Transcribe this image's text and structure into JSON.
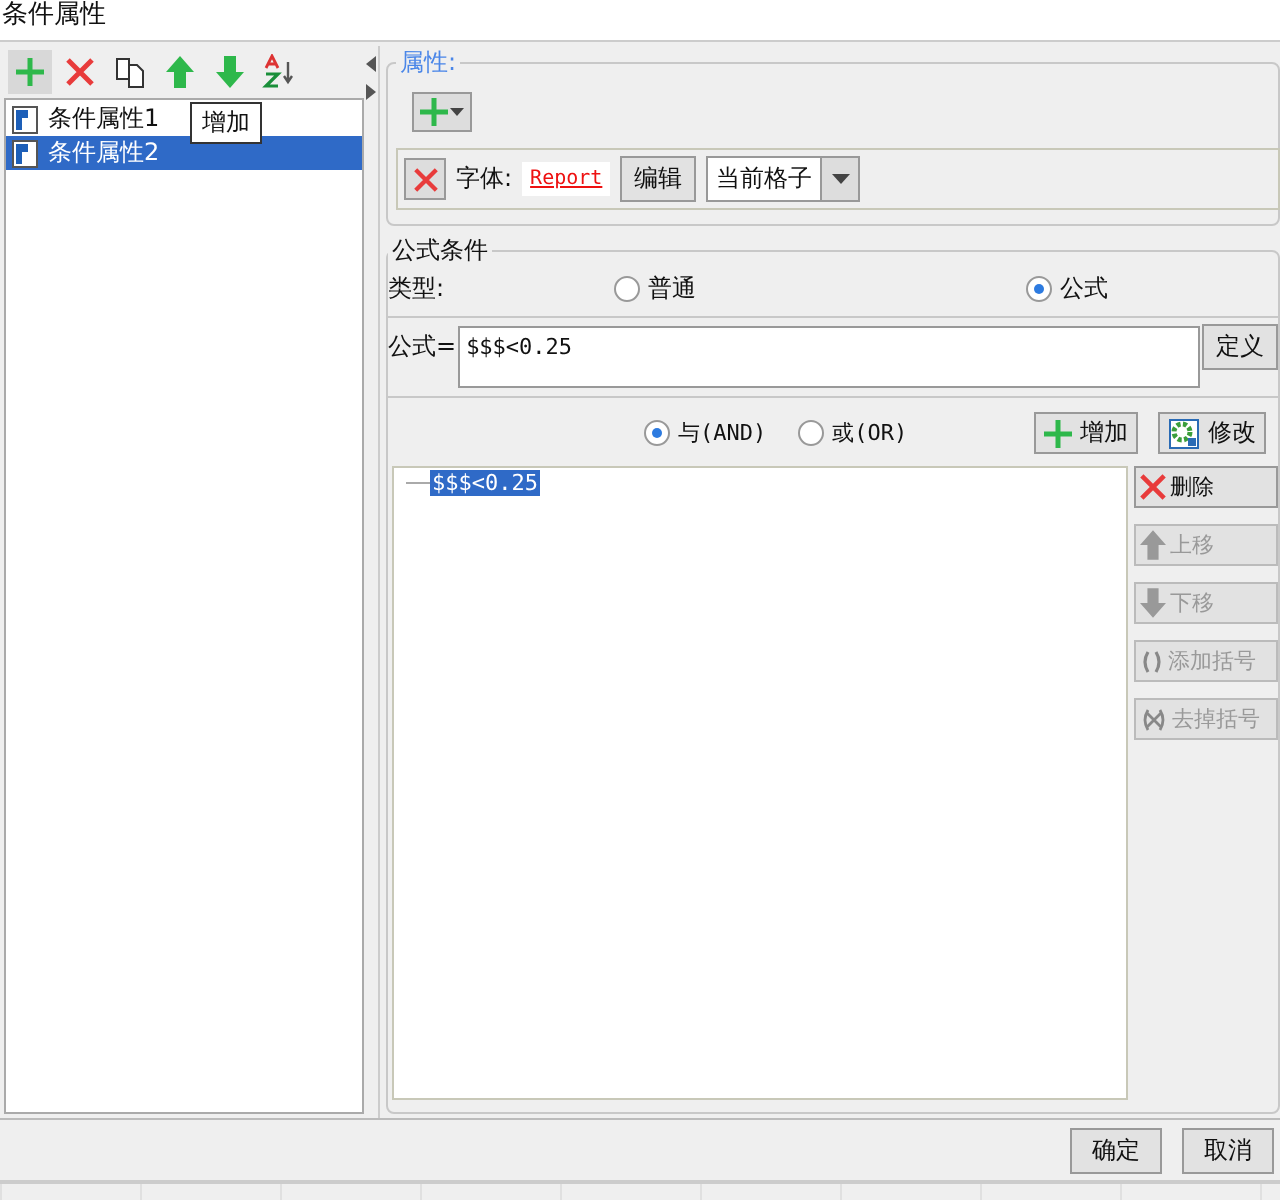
{
  "window": {
    "title": "条件属性"
  },
  "toolbar": {
    "tooltip": "增加"
  },
  "items": [
    {
      "label": "条件属性1",
      "selected": false
    },
    {
      "label": "条件属性2",
      "selected": true
    }
  ],
  "properties": {
    "legend": "属性:",
    "font_label": "字体:",
    "font_preview": "Report",
    "edit_button": "编辑",
    "scope": "当前格子"
  },
  "formula_group": {
    "legend": "公式条件",
    "type_label": "类型:",
    "types": [
      {
        "label": "普通",
        "selected": false
      },
      {
        "label": "公式",
        "selected": true
      }
    ],
    "formula_label": "公式=",
    "formula": "$$$<0.25",
    "define_button": "定义"
  },
  "logic": [
    {
      "label": "与(AND)",
      "selected": true
    },
    {
      "label": "或(OR)",
      "selected": false
    }
  ],
  "add_button": "增加",
  "modify_button": "修改",
  "conditions": [
    {
      "label": "$$$<0.25",
      "selected": true
    }
  ],
  "side_buttons": [
    {
      "kind": "delete",
      "label": "删除",
      "disabled": false
    },
    {
      "kind": "up",
      "label": "上移",
      "disabled": true
    },
    {
      "kind": "down",
      "label": "下移",
      "disabled": true
    },
    {
      "kind": "add-paren",
      "label": "添加括号",
      "disabled": true
    },
    {
      "kind": "remove-paren",
      "label": "去掉括号",
      "disabled": true
    }
  ],
  "footer": {
    "ok": "确定",
    "cancel": "取消"
  }
}
